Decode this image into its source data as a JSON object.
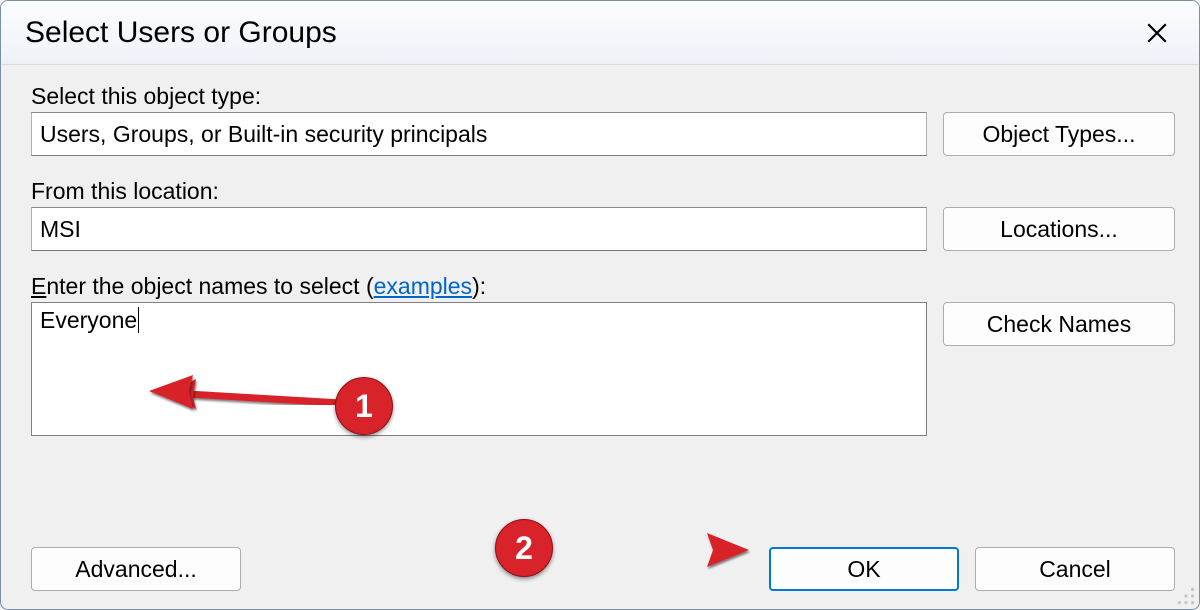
{
  "title": "Select Users or Groups",
  "object_type": {
    "label": "Select this object type:",
    "value": "Users, Groups, or Built-in security principals",
    "button": "Object Types..."
  },
  "location": {
    "label": "From this location:",
    "value": "MSI",
    "button": "Locations..."
  },
  "names": {
    "label_prefix": "E",
    "label_rest": "nter the object names to select (",
    "examples_link": "examples",
    "label_suffix": "):",
    "value": "Everyone",
    "button": "Check Names"
  },
  "footer": {
    "advanced": "Advanced...",
    "ok": "OK",
    "cancel": "Cancel"
  },
  "annotations": {
    "badge1": "1",
    "badge2": "2"
  },
  "colors": {
    "accent": "#0078d4",
    "annotation": "#d8232a",
    "link": "#0066cc"
  }
}
